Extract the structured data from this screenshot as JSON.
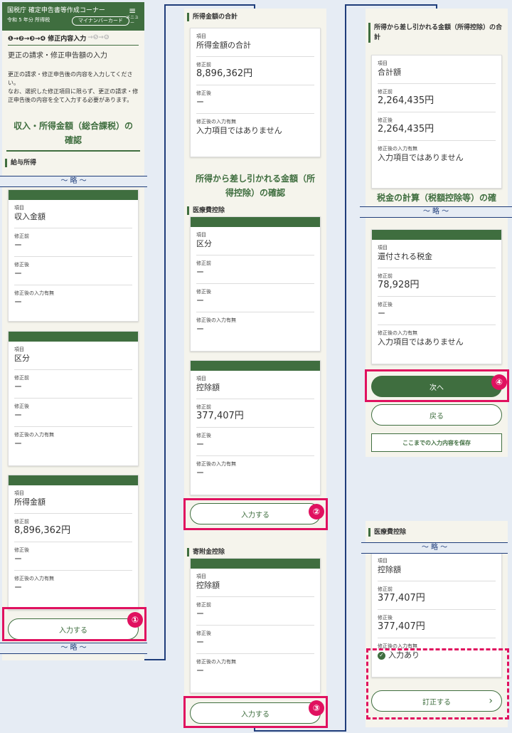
{
  "header": {
    "title": "国税庁 確定申告書等作成コーナー",
    "era": "令和 5 年分 所得税",
    "pill": "マイナンバーカード",
    "menu_label": "メニュー",
    "menu_icon": "hamburger-icon"
  },
  "steps": {
    "done": "❶→❷→❸→❹ 修正内容入力",
    "rest": "→❺→❻"
  },
  "section_title": "更正の請求・修正申告額の入力",
  "description": "更正の請求・修正申告後の内容を入力してください。\nなお、選択した修正項目に限らず、更正の請求・修正申告後の内容を全て入力する必要があります。",
  "col1": {
    "heading": "収入・所得金額（総合課税）の確認",
    "sub": "給与所得",
    "break1": "～ 略 ～",
    "cards": [
      {
        "item": "収入金額",
        "before": "ー",
        "after": "ー",
        "input": "ー"
      },
      {
        "item": "区分",
        "before": "ー",
        "after": "ー",
        "input": "ー"
      },
      {
        "item": "所得金額",
        "before": "8,896,362円",
        "after": "ー",
        "input": "ー"
      }
    ],
    "button": "入力する",
    "break2": "～ 略 ～"
  },
  "labels": {
    "item": "項目",
    "before": "修正前",
    "after": "修正後",
    "input": "修正後の入力有無"
  },
  "col2": {
    "top_sub": "所得金額の合計",
    "top_card": {
      "item": "所得金額の合計",
      "before": "8,896,362円",
      "after": "ー",
      "input": "入力項目ではありません"
    },
    "heading": "所得から差し引かれる金額（所得控除）の確認",
    "sub1": "医療費控除",
    "cards1": [
      {
        "item": "区分",
        "before": "ー",
        "after": "ー",
        "input": "ー"
      },
      {
        "item": "控除額",
        "before": "377,407円",
        "after": "ー",
        "input": "ー"
      }
    ],
    "button1": "入力する",
    "sub2": "寄附金控除",
    "card2": {
      "item": "控除額",
      "before": "ー",
      "after": "ー",
      "input": "ー"
    },
    "button2": "入力する"
  },
  "col3": {
    "sub1": "所得から差し引かれる金額（所得控除）の合計",
    "card1": {
      "item": "合計額",
      "before": "2,264,435円",
      "after": "2,264,435円",
      "input": "入力項目ではありません"
    },
    "heading": "税金の計算（税額控除等）の確",
    "break1": "～ 略 ～",
    "card2": {
      "item": "還付される税金",
      "before": "78,928円",
      "after": "ー",
      "input": "入力項目ではありません"
    },
    "next": "次へ",
    "back": "戻る",
    "save": "ここまでの入力内容を保存"
  },
  "col4": {
    "sub": "医療費控除",
    "break1": "～ 略 ～",
    "card": {
      "item": "控除額",
      "before": "377,407円",
      "after": "377,407円",
      "input": "入力あり"
    },
    "button": "訂正する",
    "chevron": "›"
  },
  "markers": [
    "①",
    "②",
    "③",
    "④"
  ]
}
